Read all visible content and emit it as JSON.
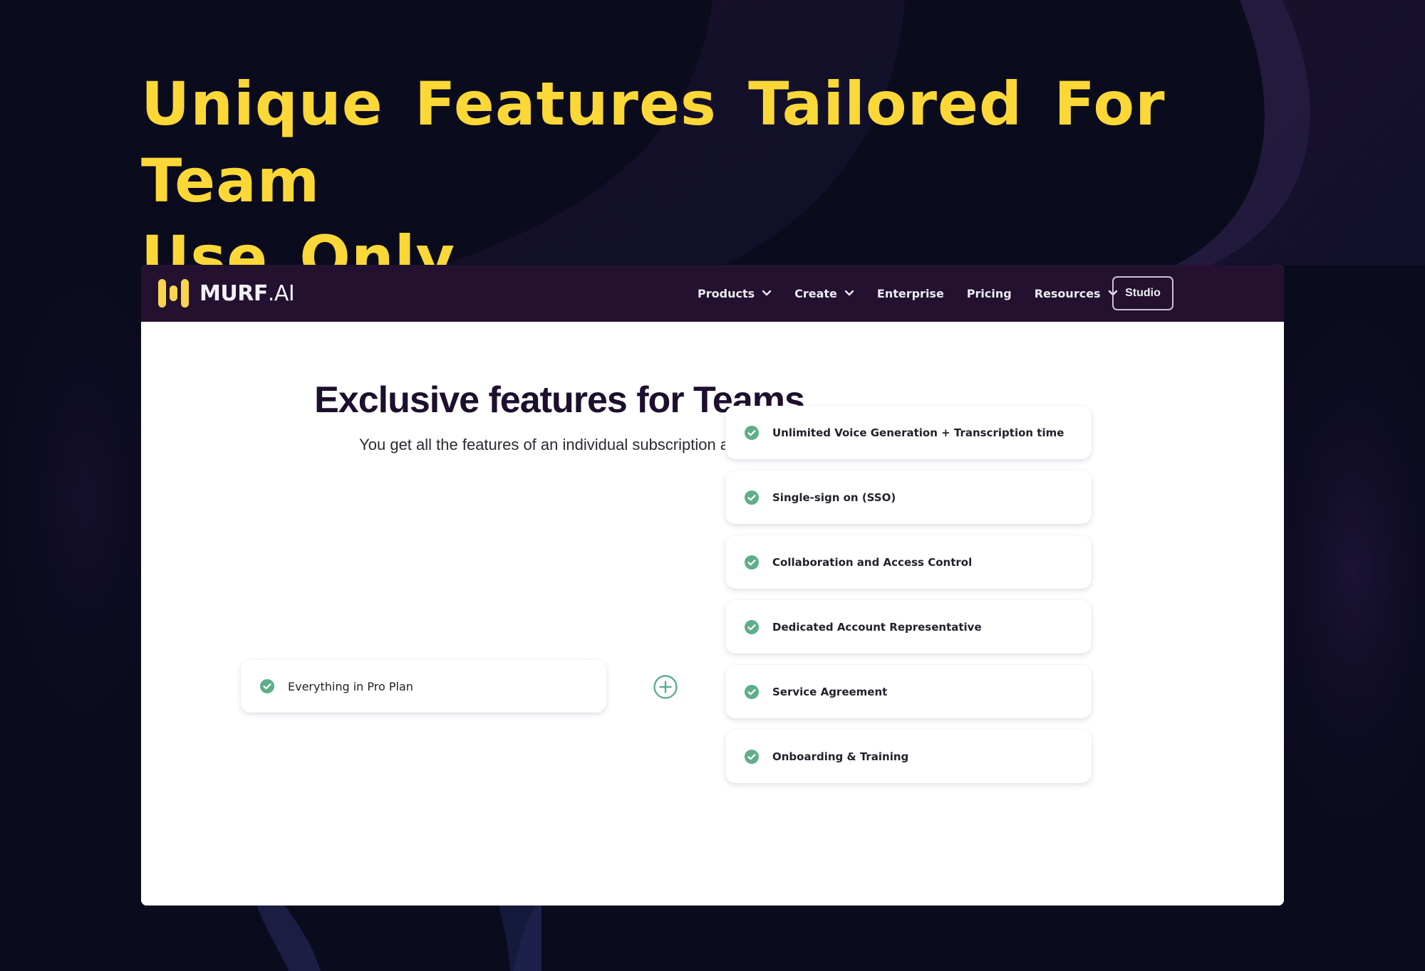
{
  "headline": {
    "line1": "Unique Features Tailored For Team",
    "line2": "Use Only"
  },
  "colors": {
    "background": "#0b0b1e",
    "headline": "#fbd837",
    "nav_background": "#23112f",
    "check_green": "#5fae8a",
    "heading_dark": "#1d0f2d"
  },
  "browser": {
    "nav": {
      "logo": {
        "brand": "MURF",
        "suffix": ".AI",
        "icon": "murf-logo-icon"
      },
      "items": [
        {
          "label": "Products",
          "has_dropdown": true
        },
        {
          "label": "Create",
          "has_dropdown": true
        },
        {
          "label": "Enterprise",
          "has_dropdown": false
        },
        {
          "label": "Pricing",
          "has_dropdown": false
        },
        {
          "label": "Resources",
          "has_dropdown": true
        }
      ],
      "cta_label": "Studio"
    },
    "main": {
      "title": "Exclusive features for Teams",
      "subtitle": "You get all the features of an individual subscription and...",
      "base_plan": {
        "label": "Everything in Pro Plan",
        "icon": "check-circle-icon"
      },
      "connector_icon": "plus-circle-icon",
      "features": [
        {
          "label": "Unlimited Voice Generation + Transcription time",
          "icon": "check-circle-icon"
        },
        {
          "label": "Single-sign on (SSO)",
          "icon": "check-circle-icon"
        },
        {
          "label": "Collaboration and Access Control",
          "icon": "check-circle-icon"
        },
        {
          "label": "Dedicated Account Representative",
          "icon": "check-circle-icon"
        },
        {
          "label": "Service Agreement",
          "icon": "check-circle-icon"
        },
        {
          "label": "Onboarding & Training",
          "icon": "check-circle-icon"
        }
      ]
    }
  }
}
